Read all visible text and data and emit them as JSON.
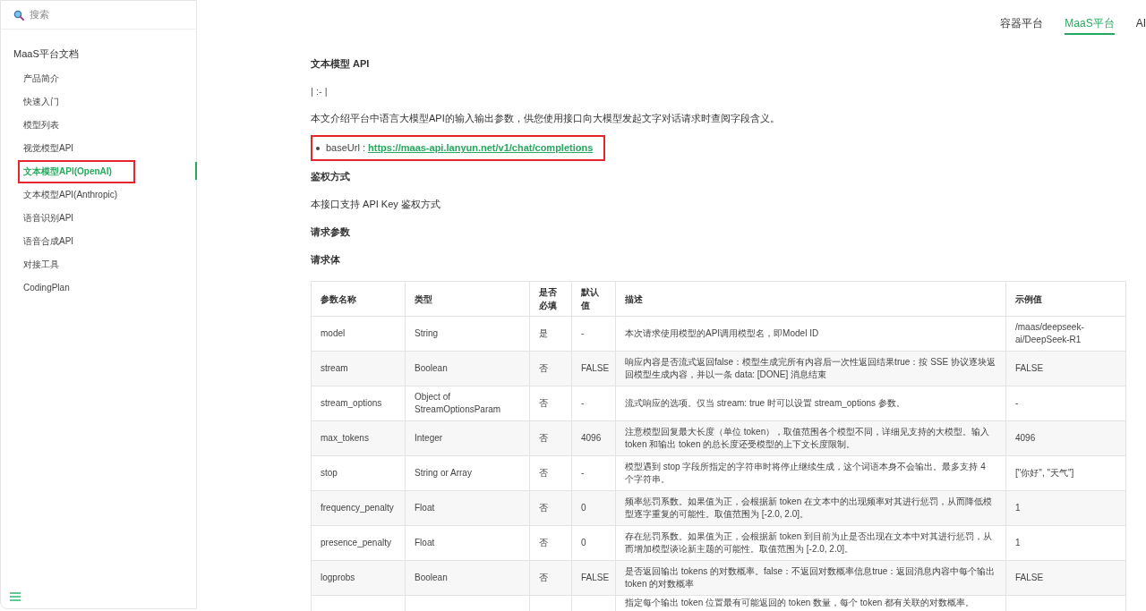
{
  "sidebar": {
    "search": {
      "placeholder": "搜索"
    },
    "section_title": "MaaS平台文档",
    "items": [
      {
        "label": "产品简介",
        "selected": false,
        "highlighted": false
      },
      {
        "label": "快速入门",
        "selected": false,
        "highlighted": false
      },
      {
        "label": "模型列表",
        "selected": false,
        "highlighted": false
      },
      {
        "label": "视觉模型API",
        "selected": false,
        "highlighted": false
      },
      {
        "label": "文本模型API(OpenAI)",
        "selected": true,
        "highlighted": true
      },
      {
        "label": "文本模型API(Anthropic)",
        "selected": false,
        "highlighted": false
      },
      {
        "label": "语音识别API",
        "selected": false,
        "highlighted": false
      },
      {
        "label": "语音合成API",
        "selected": false,
        "highlighted": false
      },
      {
        "label": "对接工具",
        "selected": false,
        "highlighted": false
      },
      {
        "label": "CodingPlan",
        "selected": false,
        "highlighted": false
      }
    ]
  },
  "top_nav": [
    {
      "label": "容器平台",
      "selected": false
    },
    {
      "label": "MaaS平台",
      "selected": true
    },
    {
      "label": "AI",
      "selected": false
    }
  ],
  "content": {
    "title": "文本模型 API",
    "separator": "| :- |",
    "intro": "本文介绍平台中语言大模型API的输入输出参数，供您使用接口向大模型发起文字对话请求时查阅字段含义。",
    "base_url": {
      "label": "baseUrl : ",
      "link": "https://maas-api.lanyun.net/v1/chat/completions",
      "highlighted": true
    },
    "auth_heading": "鉴权方式",
    "auth_text": "本接口支持 API Key 鉴权方式",
    "params_heading": "请求参数",
    "body_heading": "请求体"
  },
  "table": {
    "columns": [
      "参数名称",
      "类型",
      "是否必填",
      "默认值",
      "描述",
      "示例值"
    ],
    "rows": [
      [
        "model",
        "String",
        "是",
        "-",
        "本次请求使用模型的API调用模型名，即Model ID",
        "/maas/deepseek-ai/DeepSeek-R1"
      ],
      [
        "stream",
        "Boolean",
        "否",
        "FALSE",
        "响应内容是否流式返回false：模型生成完所有内容后一次性返回结果true：按 SSE 协议逐块返回模型生成内容，并以一条 data: [DONE] 消息结束",
        "FALSE"
      ],
      [
        "stream_options",
        "Object of StreamOptionsParam",
        "否",
        "-",
        "流式响应的选项。仅当 stream: true 时可以设置 stream_options 参数。",
        "-"
      ],
      [
        "max_tokens",
        "Integer",
        "否",
        "4096",
        "注意模型回复最大长度（单位 token），取值范围各个模型不同，详细见支持的大模型。输入 token 和输出 token 的总长度还受模型的上下文长度限制。",
        "4096"
      ],
      [
        "stop",
        "String or Array",
        "否",
        "-",
        "模型遇到 stop 字段所指定的字符串时将停止继续生成，这个词语本身不会输出。最多支持 4 个字符串。",
        "[\"你好\", \"天气\"]"
      ],
      [
        "frequency_penalty",
        "Float",
        "否",
        "0",
        "频率惩罚系数。如果值为正，会根据新 token 在文本中的出现频率对其进行惩罚，从而降低模型逐字重复的可能性。取值范围为 [-2.0, 2.0]。",
        "1"
      ],
      [
        "presence_penalty",
        "Float",
        "否",
        "0",
        "存在惩罚系数。如果值为正，会根据新 token 到目前为止是否出现在文本中对其进行惩罚，从而增加模型谈论新主题的可能性。取值范围为 [-2.0, 2.0]。",
        "1"
      ],
      [
        "logprobs",
        "Boolean",
        "否",
        "FALSE",
        "是否返回输出 tokens 的对数概率。false：不返回对数概率信息true：返回消息内容中每个输出 token 的对数概率",
        "FALSE"
      ],
      [
        "",
        "",
        "",
        "",
        "指定每个输出 token 位置最有可能返回的 token 数量，每个 token 都有关联的对数概率。",
        ""
      ]
    ]
  }
}
